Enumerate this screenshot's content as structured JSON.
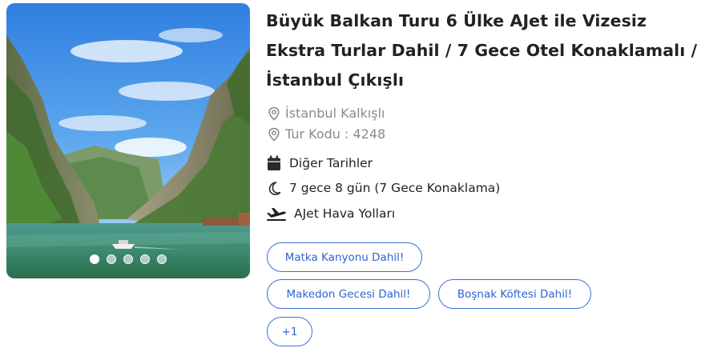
{
  "tour": {
    "title": "Büyük Balkan Turu 6 Ülke AJet ile Vizesiz Ekstra Turlar Dahil / 7 Gece Otel Konaklamalı / İstanbul Çıkışlı",
    "departure": "İstanbul Kalkışlı",
    "tour_code": "Tur Kodu : 4248",
    "other_dates": "Diğer Tarihler",
    "duration": "7 gece 8 gün (7 Gece Konaklama)",
    "airline": "AJet Hava Yolları",
    "tags": [
      "Matka Kanyonu Dahil!",
      "Makedon Gecesi Dahil!",
      "Boşnak Köftesi Dahil!"
    ],
    "more_tags": "+1"
  },
  "gallery": {
    "slide_count": 5,
    "active_slide": 1
  },
  "colors": {
    "accent": "#3d6fd6",
    "title": "#222222",
    "muted": "#8a8a8a"
  },
  "icons": {
    "departure": "location-pin-icon",
    "tour_code": "location-pin-icon",
    "other_dates": "calendar-icon",
    "duration": "moon-icon",
    "airline": "airplane-icon"
  }
}
